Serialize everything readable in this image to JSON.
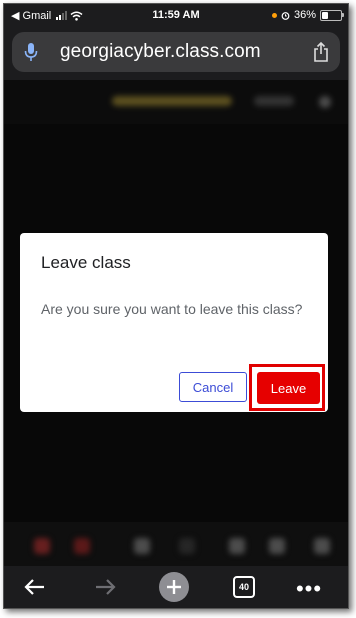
{
  "status_bar": {
    "carrier": "◀ Gmail",
    "time": "11:59 AM",
    "battery": "36%"
  },
  "address_bar": {
    "url": "georgiacyber.class.com",
    "mic_icon": "microphone-icon",
    "share_icon": "share-icon"
  },
  "dialog": {
    "title": "Leave class",
    "message": "Are you sure you want to leave this class?",
    "cancel_label": "Cancel",
    "leave_label": "Leave",
    "accent_color": "#3c4cd6",
    "leave_color": "#e60000",
    "highlight_color": "#e00000"
  },
  "toolbar": {
    "back_icon": "back-arrow-icon",
    "forward_icon": "forward-arrow-icon",
    "new_tab_icon": "plus-icon",
    "tabs_count": "40",
    "more_icon": "more-dots-icon"
  }
}
